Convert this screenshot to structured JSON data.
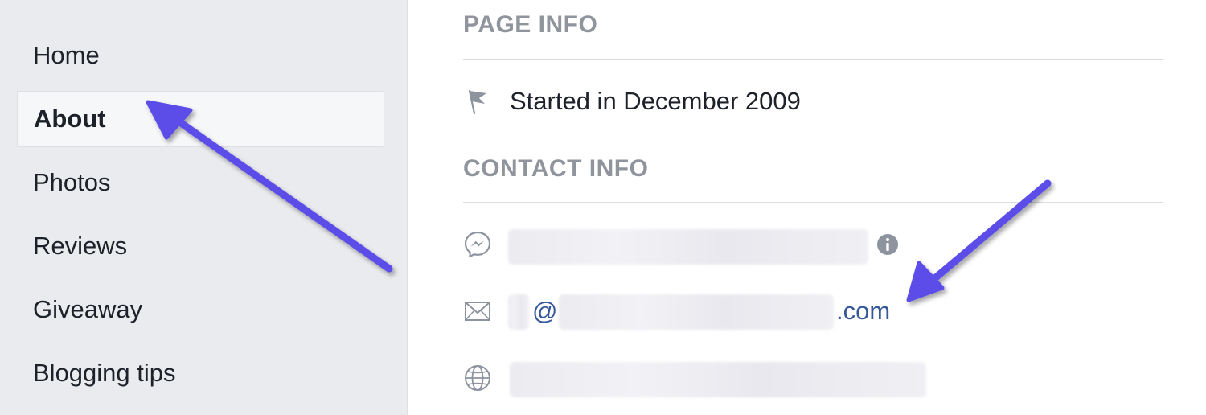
{
  "sidebar": {
    "items": [
      {
        "label": "Home",
        "active": false
      },
      {
        "label": "About",
        "active": true
      },
      {
        "label": "Photos",
        "active": false
      },
      {
        "label": "Reviews",
        "active": false
      },
      {
        "label": "Giveaway",
        "active": false
      },
      {
        "label": "Blogging tips",
        "active": false
      }
    ]
  },
  "page_info": {
    "title": "PAGE INFO",
    "started": "Started in December 2009"
  },
  "contact_info": {
    "title": "CONTACT INFO",
    "email_at": "@",
    "email_tld": ".com"
  },
  "icons": {
    "flag": "flag-icon",
    "messenger": "messenger-icon",
    "info": "info-icon",
    "email": "envelope-icon",
    "website": "globe-icon"
  },
  "colors": {
    "arrow": "#5b4de8",
    "link": "#365899",
    "section_title": "#90949c",
    "sidebar_bg": "#e9ebee"
  }
}
